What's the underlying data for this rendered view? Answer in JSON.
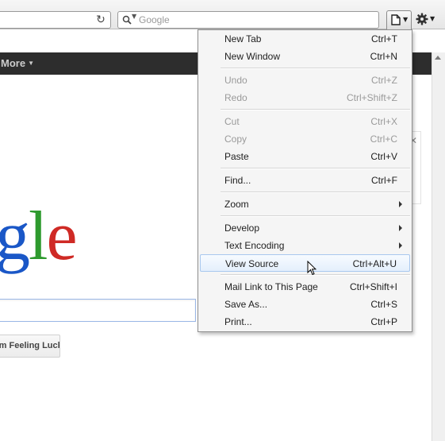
{
  "toolbar": {
    "search_placeholder": "Google"
  },
  "page": {
    "more_label": "More",
    "logo_parts": [
      "g",
      "l",
      "e"
    ],
    "lucky_button": "I'm Feeling Lucky"
  },
  "menu": {
    "new_tab": {
      "label": "New Tab",
      "shortcut": "Ctrl+T"
    },
    "new_window": {
      "label": "New Window",
      "shortcut": "Ctrl+N"
    },
    "undo": {
      "label": "Undo",
      "shortcut": "Ctrl+Z"
    },
    "redo": {
      "label": "Redo",
      "shortcut": "Ctrl+Shift+Z"
    },
    "cut": {
      "label": "Cut",
      "shortcut": "Ctrl+X"
    },
    "copy": {
      "label": "Copy",
      "shortcut": "Ctrl+C"
    },
    "paste": {
      "label": "Paste",
      "shortcut": "Ctrl+V"
    },
    "find": {
      "label": "Find...",
      "shortcut": "Ctrl+F"
    },
    "zoom": {
      "label": "Zoom"
    },
    "develop": {
      "label": "Develop"
    },
    "text_encoding": {
      "label": "Text Encoding"
    },
    "view_source": {
      "label": "View Source",
      "shortcut": "Ctrl+Alt+U"
    },
    "mail_link": {
      "label": "Mail Link to This Page",
      "shortcut": "Ctrl+Shift+I"
    },
    "save_as": {
      "label": "Save As...",
      "shortcut": "Ctrl+S"
    },
    "print": {
      "label": "Print...",
      "shortcut": "Ctrl+P"
    }
  },
  "colors": {
    "logo_blue": "#1a57c7",
    "logo_green": "#2e9a2e",
    "logo_red": "#cf2a25",
    "menu_highlight_border": "#a9c8ee",
    "google_bar": "#2d2d2d"
  }
}
